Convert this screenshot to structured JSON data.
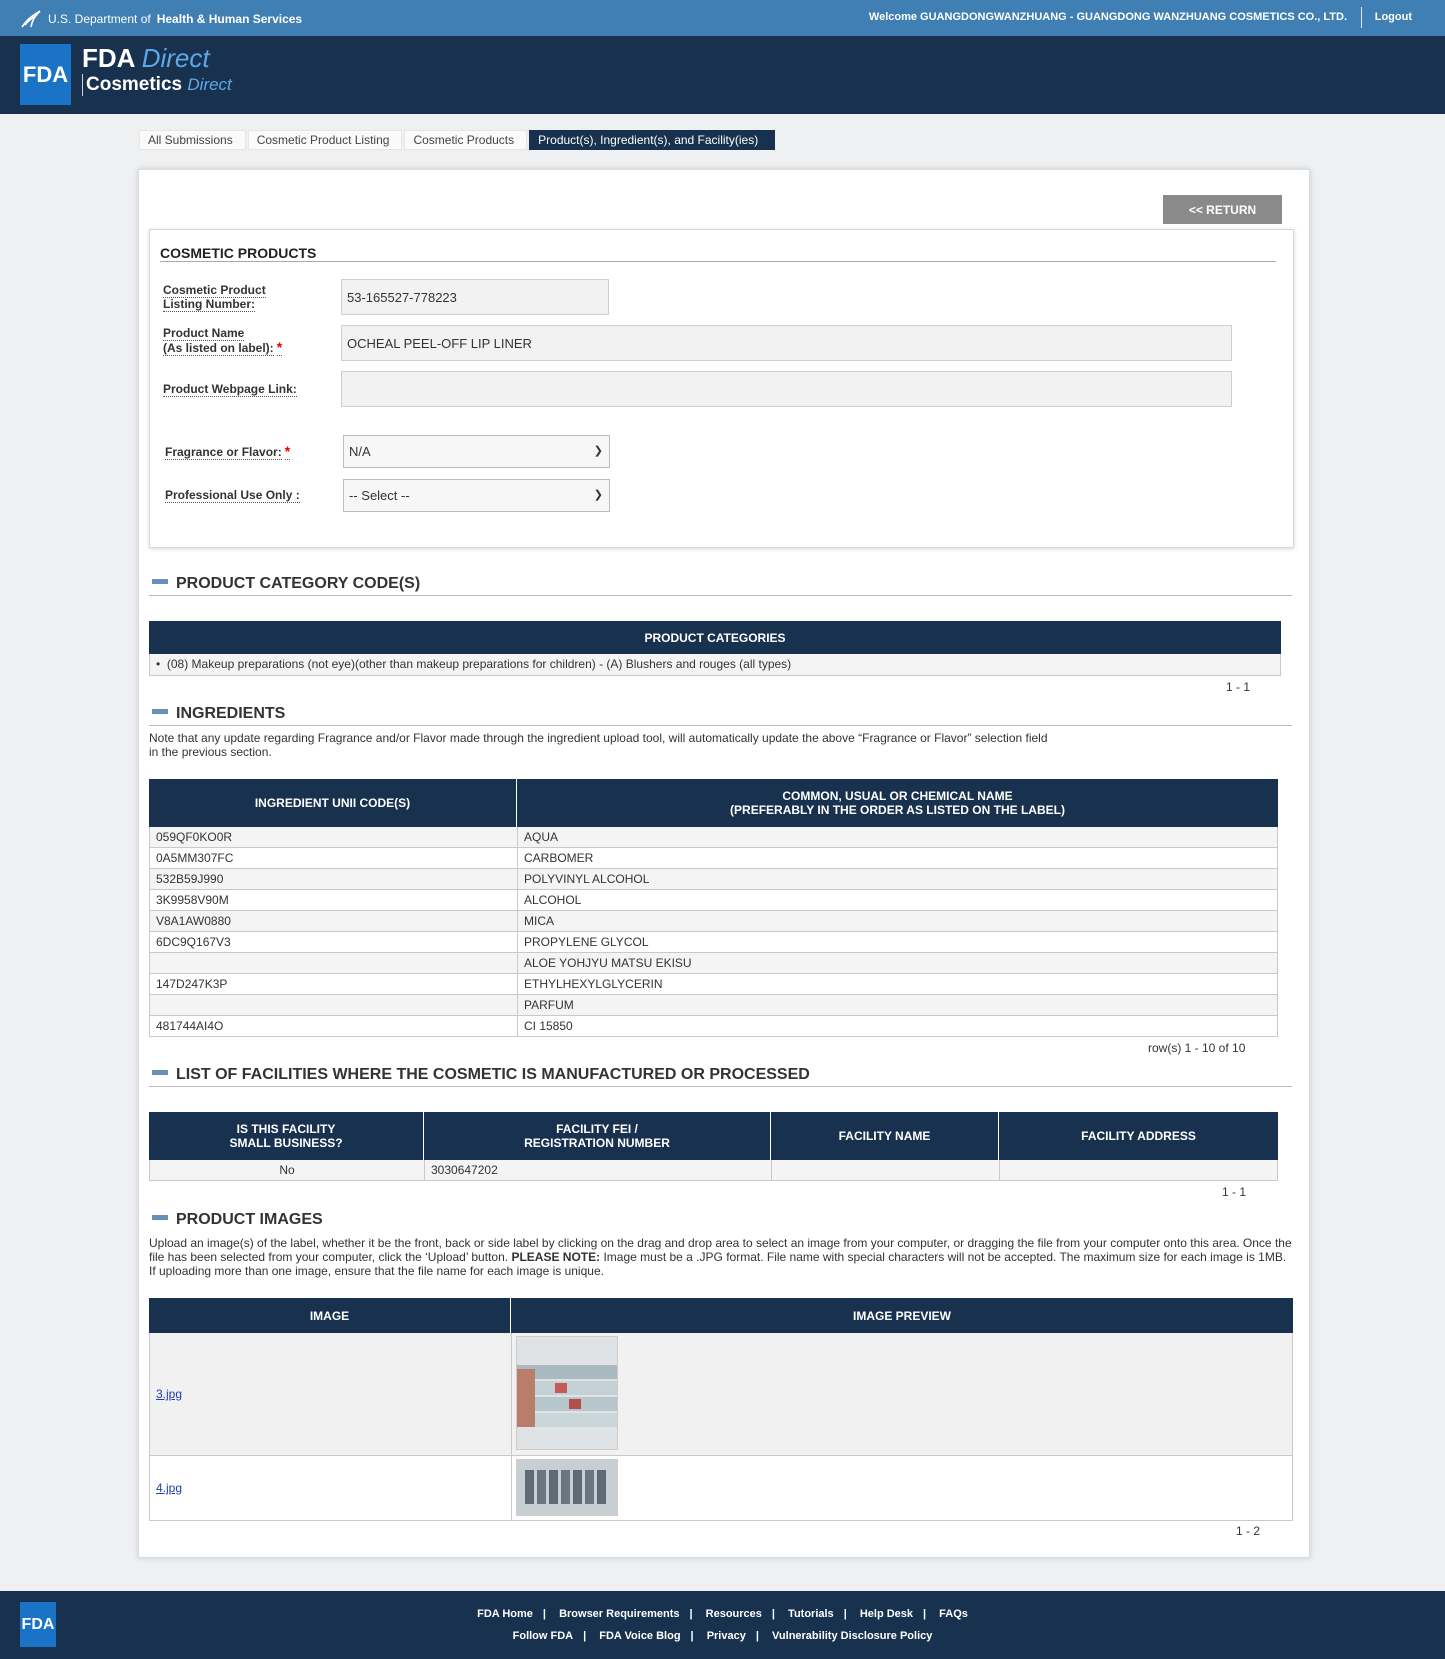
{
  "header": {
    "hhs_prefix": "U.S. Department of",
    "hhs_name": "Health & Human Services",
    "welcome": "Welcome GUANGDONGWANZHUANG - GUANGDONG WANZHUANG COSMETICS CO., LTD.",
    "logout": "Logout"
  },
  "brand": {
    "logo": "FDA",
    "line1_bold": "FDA",
    "line1_italic": "Direct",
    "line2_bold": "Cosmetics",
    "line2_italic": "Direct"
  },
  "breadcrumb": [
    "All Submissions",
    "Cosmetic Product Listing",
    "Cosmetic Products",
    "Product(s), Ingredient(s), and Facility(ies)"
  ],
  "return_label": "<< RETURN",
  "cosmetic_products": {
    "title": "COSMETIC PRODUCTS",
    "listing_label_1": "Cosmetic Product",
    "listing_label_2": "Listing Number:",
    "listing_value": "53-165527-778223",
    "name_label_1": "Product Name",
    "name_label_2": "(As listed on label):",
    "name_value": "OCHEAL PEEL-OFF LIP LINER",
    "webpage_label": "Product Webpage Link:",
    "webpage_value": "",
    "fragrance_label": "Fragrance or Flavor:",
    "fragrance_value": "N/A",
    "prof_label": "Professional Use Only :",
    "prof_value": "-- Select --"
  },
  "categories": {
    "title": "PRODUCT CATEGORY CODE(S)",
    "header": "PRODUCT CATEGORIES",
    "item": "(08) Makeup preparations (not eye)(other than makeup preparations for children) - (A) Blushers and rouges (all types)",
    "pager": "1 - 1"
  },
  "ingredients": {
    "title": "INGREDIENTS",
    "note_1": "Note that any update regarding Fragrance and/or Flavor made through the ingredient upload tool, will automatically update the above “Fragrance or Flavor” selection field",
    "note_2": "in the previous section.",
    "col1": "INGREDIENT UNII CODE(S)",
    "col2_1": "COMMON, USUAL OR CHEMICAL NAME",
    "col2_2": "(PREFERABLY IN THE ORDER AS LISTED ON THE LABEL)",
    "rows": [
      {
        "code": "059QF0KO0R",
        "name": "AQUA"
      },
      {
        "code": "0A5MM307FC",
        "name": "CARBOMER"
      },
      {
        "code": "532B59J990",
        "name": "POLYVINYL ALCOHOL"
      },
      {
        "code": "3K9958V90M",
        "name": "ALCOHOL"
      },
      {
        "code": "V8A1AW0880",
        "name": "MICA"
      },
      {
        "code": "6DC9Q167V3",
        "name": "PROPYLENE GLYCOL"
      },
      {
        "code": "",
        "name": "ALOE YOHJYU MATSU EKISU"
      },
      {
        "code": "147D247K3P",
        "name": "ETHYLHEXYLGLYCERIN"
      },
      {
        "code": "",
        "name": "PARFUM"
      },
      {
        "code": "481744AI4O",
        "name": "CI 15850"
      }
    ],
    "pager": "row(s) 1 - 10 of 10"
  },
  "facilities": {
    "title": "LIST OF FACILITIES WHERE THE COSMETIC IS MANUFACTURED OR PROCESSED",
    "col1_1": "IS THIS FACILITY",
    "col1_2": "SMALL BUSINESS?",
    "col2_1": "FACILITY FEI /",
    "col2_2": "REGISTRATION NUMBER",
    "col3": "FACILITY NAME",
    "col4": "FACILITY ADDRESS",
    "row": {
      "small": "No",
      "fei": "3030647202",
      "name": "",
      "address": ""
    },
    "pager": "1 - 1"
  },
  "images": {
    "title": "PRODUCT IMAGES",
    "note_1": "Upload an image(s) of the label, whether it be the front, back or side label by clicking on the drag and drop area to select an image from your computer, or dragging the file from your computer onto this area. Once the",
    "note_2a": "file has been selected from your computer, click the ‘Upload’ button.",
    "note_2b": "PLEASE NOTE:",
    "note_2c": "Image must be a .JPG format. File name with special characters will not be accepted. The maximum size for each image is 1MB.",
    "note_3": "If uploading more than one image, ensure that the file name for each image is unique.",
    "col1": "IMAGE",
    "col2": "IMAGE PREVIEW",
    "rows": [
      {
        "file": "3.jpg"
      },
      {
        "file": "4.jpg"
      }
    ],
    "pager": "1 - 2"
  },
  "footer": {
    "logo": "FDA",
    "row1": [
      "FDA Home",
      "Browser Requirements",
      "Resources",
      "Tutorials",
      "Help Desk",
      "FAQs"
    ],
    "row2": [
      "Follow FDA",
      "FDA Voice Blog",
      "Privacy",
      "Vulnerability Disclosure Policy"
    ]
  }
}
